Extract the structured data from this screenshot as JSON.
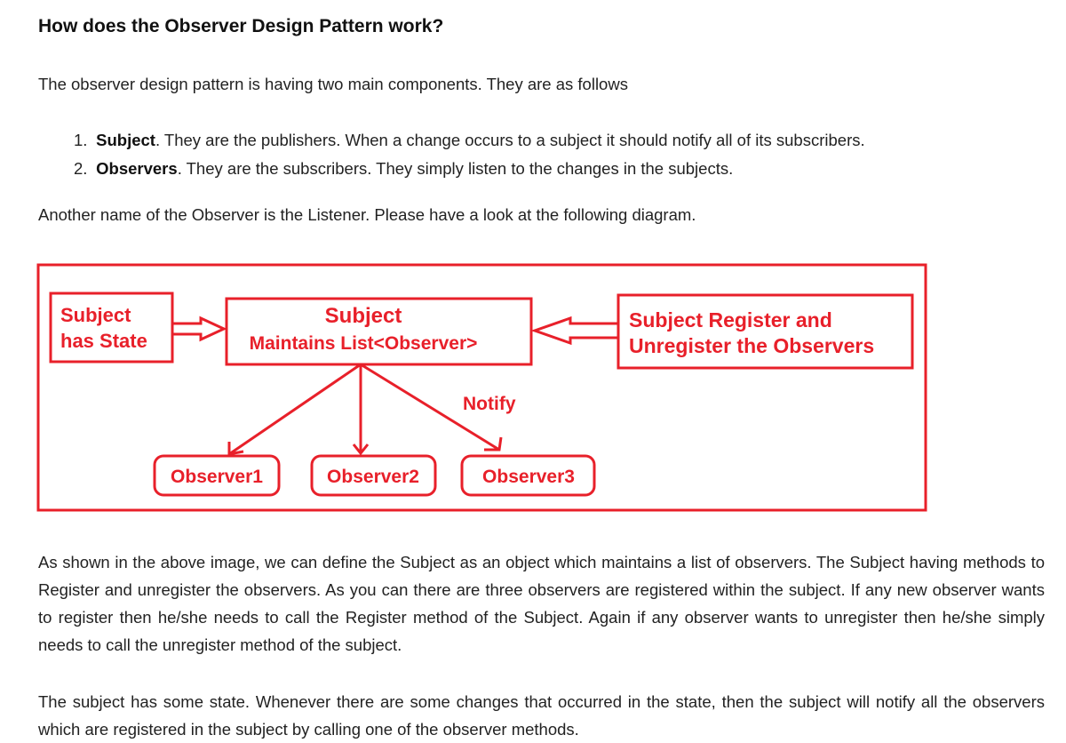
{
  "heading": "How does the Observer Design Pattern work?",
  "intro": "The observer design pattern is having two main components. They are as follows",
  "components": [
    {
      "number": "1.",
      "term": "Subject",
      "desc": ". They are the publishers. When a change occurs to a subject it should notify all of its subscribers."
    },
    {
      "number": "2.",
      "term": "Observers",
      "desc": ". They are the subscribers. They simply listen to the changes in the subjects."
    }
  ],
  "another": "Another name of the Observer is the Listener. Please have a look at the following diagram.",
  "diagram": {
    "state_box": [
      "Subject",
      "has State"
    ],
    "subject_box": [
      "Subject",
      "Maintains List<Observer>"
    ],
    "register_box": [
      "Subject Register and",
      "Unregister the Observers"
    ],
    "notify_label": "Notify",
    "observers": [
      "Observer1",
      "Observer2",
      "Observer3"
    ],
    "color": "#e8202a"
  },
  "paragraph1": "As shown in the above image, we can define the Subject as an object which maintains a list of observers. The Subject having methods to Register and unregister the observers. As you can there are three observers are registered within the subject. If any new observer wants to register then he/she needs to call the Register method of the Subject. Again if any observer wants to unregister then he/she simply needs to call the unregister method of the subject.",
  "paragraph2": "The subject has some state. Whenever there are some changes that occurred in the state, then the subject will notify all the observers which are registered in the subject by calling one of the observer methods."
}
